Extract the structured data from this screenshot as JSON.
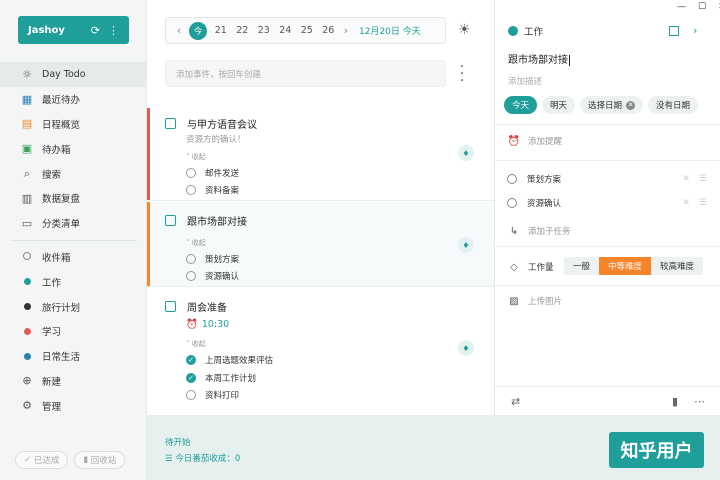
{
  "sidebar": {
    "user": "Jashoy",
    "items": [
      {
        "label": "Day Todo",
        "icon": "sun-icon",
        "glyph": "☼"
      },
      {
        "label": "最近待办",
        "icon": "calendar-icon",
        "glyph": "▦"
      },
      {
        "label": "日程概览",
        "icon": "schedule-icon",
        "glyph": "▤"
      },
      {
        "label": "待办箱",
        "icon": "inbox-icon",
        "glyph": "▣"
      },
      {
        "label": "搜索",
        "icon": "search-icon",
        "glyph": "⌕"
      },
      {
        "label": "数据复盘",
        "icon": "chart-icon",
        "glyph": "▥"
      },
      {
        "label": "分类清单",
        "icon": "list-icon",
        "glyph": "▭"
      }
    ],
    "lists": [
      {
        "label": "收件箱",
        "type": "ring",
        "color": "#888888"
      },
      {
        "label": "工作",
        "type": "dot",
        "color": "#1f9e9a"
      },
      {
        "label": "旅行计划",
        "type": "dot",
        "color": "#333333"
      },
      {
        "label": "学习",
        "type": "dot",
        "color": "#e05a5a"
      },
      {
        "label": "日常生活",
        "type": "dot",
        "color": "#2a7fb0"
      }
    ],
    "new_label": "新建",
    "manage_label": "管理",
    "done_label": "已达成",
    "trash_label": "回收站"
  },
  "datebar": {
    "today_label": "今",
    "days": [
      "21",
      "22",
      "23",
      "24",
      "25",
      "26"
    ],
    "date_text": "12月20日 今天"
  },
  "add_placeholder": "添加事件，按回车创建",
  "tasks": [
    {
      "title": "与甲方语音会议",
      "subtitle": "资源方的确认！",
      "collapse": "收起",
      "subs": [
        {
          "label": "邮件发送",
          "done": false
        },
        {
          "label": "资料备案",
          "done": false
        }
      ]
    },
    {
      "title": "跟市场部对接",
      "collapse": "收起",
      "subs": [
        {
          "label": "策划方案",
          "done": false
        },
        {
          "label": "资源确认",
          "done": false
        }
      ]
    },
    {
      "title": "周会准备",
      "time": "10:30",
      "collapse": "收起",
      "subs": [
        {
          "label": "上周选题效果评估",
          "done": true
        },
        {
          "label": "本周工作计划",
          "done": true
        },
        {
          "label": "资料打印",
          "done": false
        }
      ]
    }
  ],
  "bottom": {
    "status": "待开始",
    "harvest": "今日番茄收成：0",
    "watermark": "知乎用户"
  },
  "detail": {
    "list_name": "工作",
    "title": "跟市场部对接",
    "desc_placeholder": "添加描述",
    "chips": [
      "今天",
      "明天",
      "选择日期",
      "没有日期"
    ],
    "reminder": "添加提醒",
    "subtasks": [
      "策划方案",
      "资源确认"
    ],
    "add_subtask": "添加子任务",
    "workload_label": "工作量",
    "workload": [
      "一般",
      "中等难度",
      "较高难度"
    ],
    "upload": "上传图片"
  },
  "colors": {
    "accent": "#1f9e9a",
    "orange": "#f5842a",
    "red": "#e05a5a"
  }
}
